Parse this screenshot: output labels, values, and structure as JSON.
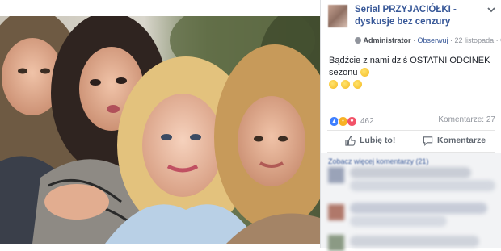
{
  "post": {
    "page_name_visible": "Serial PRZYJACIÓŁKI - dyskusje bez cenzury",
    "page_name_blurred": "",
    "admin_label": "Administrator",
    "follow_label": "Obserwuj",
    "date": "22 listopada",
    "text": "Bądźcie z nami dziś OSTATNI ODCINEK sezonu",
    "reaction_count": "462",
    "comments_label": "Komentarze: 27",
    "like_action": "Lubię to!",
    "comment_action": "Komentarze",
    "more_comments": "Zobacz więcej komentarzy (21)"
  },
  "colors": {
    "link": "#385898",
    "muted": "#90949c",
    "like_blue": "#4080ff",
    "comments_bg": "#f2f3f5"
  },
  "icons": [
    "globe-icon",
    "dropdown-icon",
    "like-reaction-icon",
    "haha-reaction-icon",
    "love-reaction-icon",
    "thumbs-up-icon",
    "comment-bubble-icon"
  ]
}
